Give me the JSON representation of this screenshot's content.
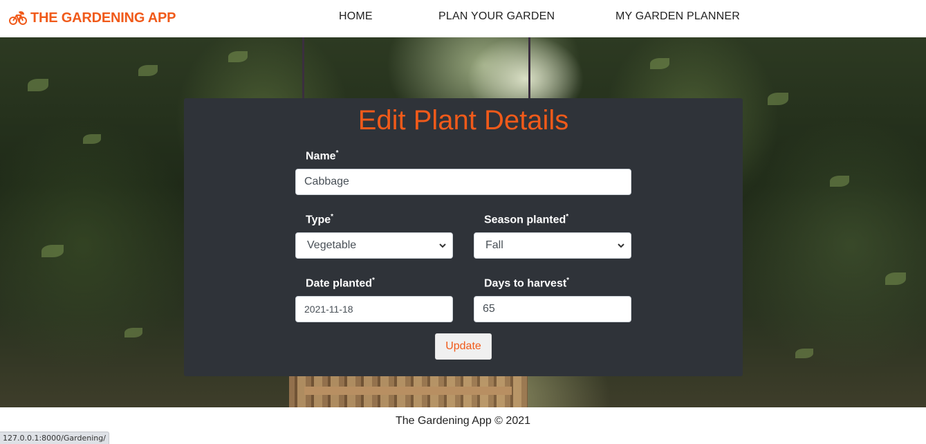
{
  "navbar": {
    "brand": "THE GARDENING APP",
    "brand_icon": "bicycle-leaf-icon",
    "links": [
      {
        "label": "HOME"
      },
      {
        "label": "PLAN YOUR GARDEN"
      },
      {
        "label": "MY GARDEN PLANNER"
      }
    ]
  },
  "form": {
    "title": "Edit Plant Details",
    "name": {
      "label": "Name",
      "required_mark": "*",
      "value": "Cabbage"
    },
    "type": {
      "label": "Type",
      "required_mark": "*",
      "selected": "Vegetable"
    },
    "season": {
      "label": "Season planted",
      "required_mark": "*",
      "selected": "Fall"
    },
    "date_planted": {
      "label": "Date planted",
      "required_mark": "*",
      "value": "2021-11-18"
    },
    "days_to_harvest": {
      "label": "Days to harvest",
      "required_mark": "*",
      "value": "65"
    },
    "submit_label": "Update"
  },
  "footer": {
    "text": "The Gardening App © 2021"
  },
  "status_bar": {
    "url": "127.0.0.1:8000/Gardening/"
  },
  "colors": {
    "accent": "#f05a1a",
    "card_bg": "#2f3339"
  }
}
